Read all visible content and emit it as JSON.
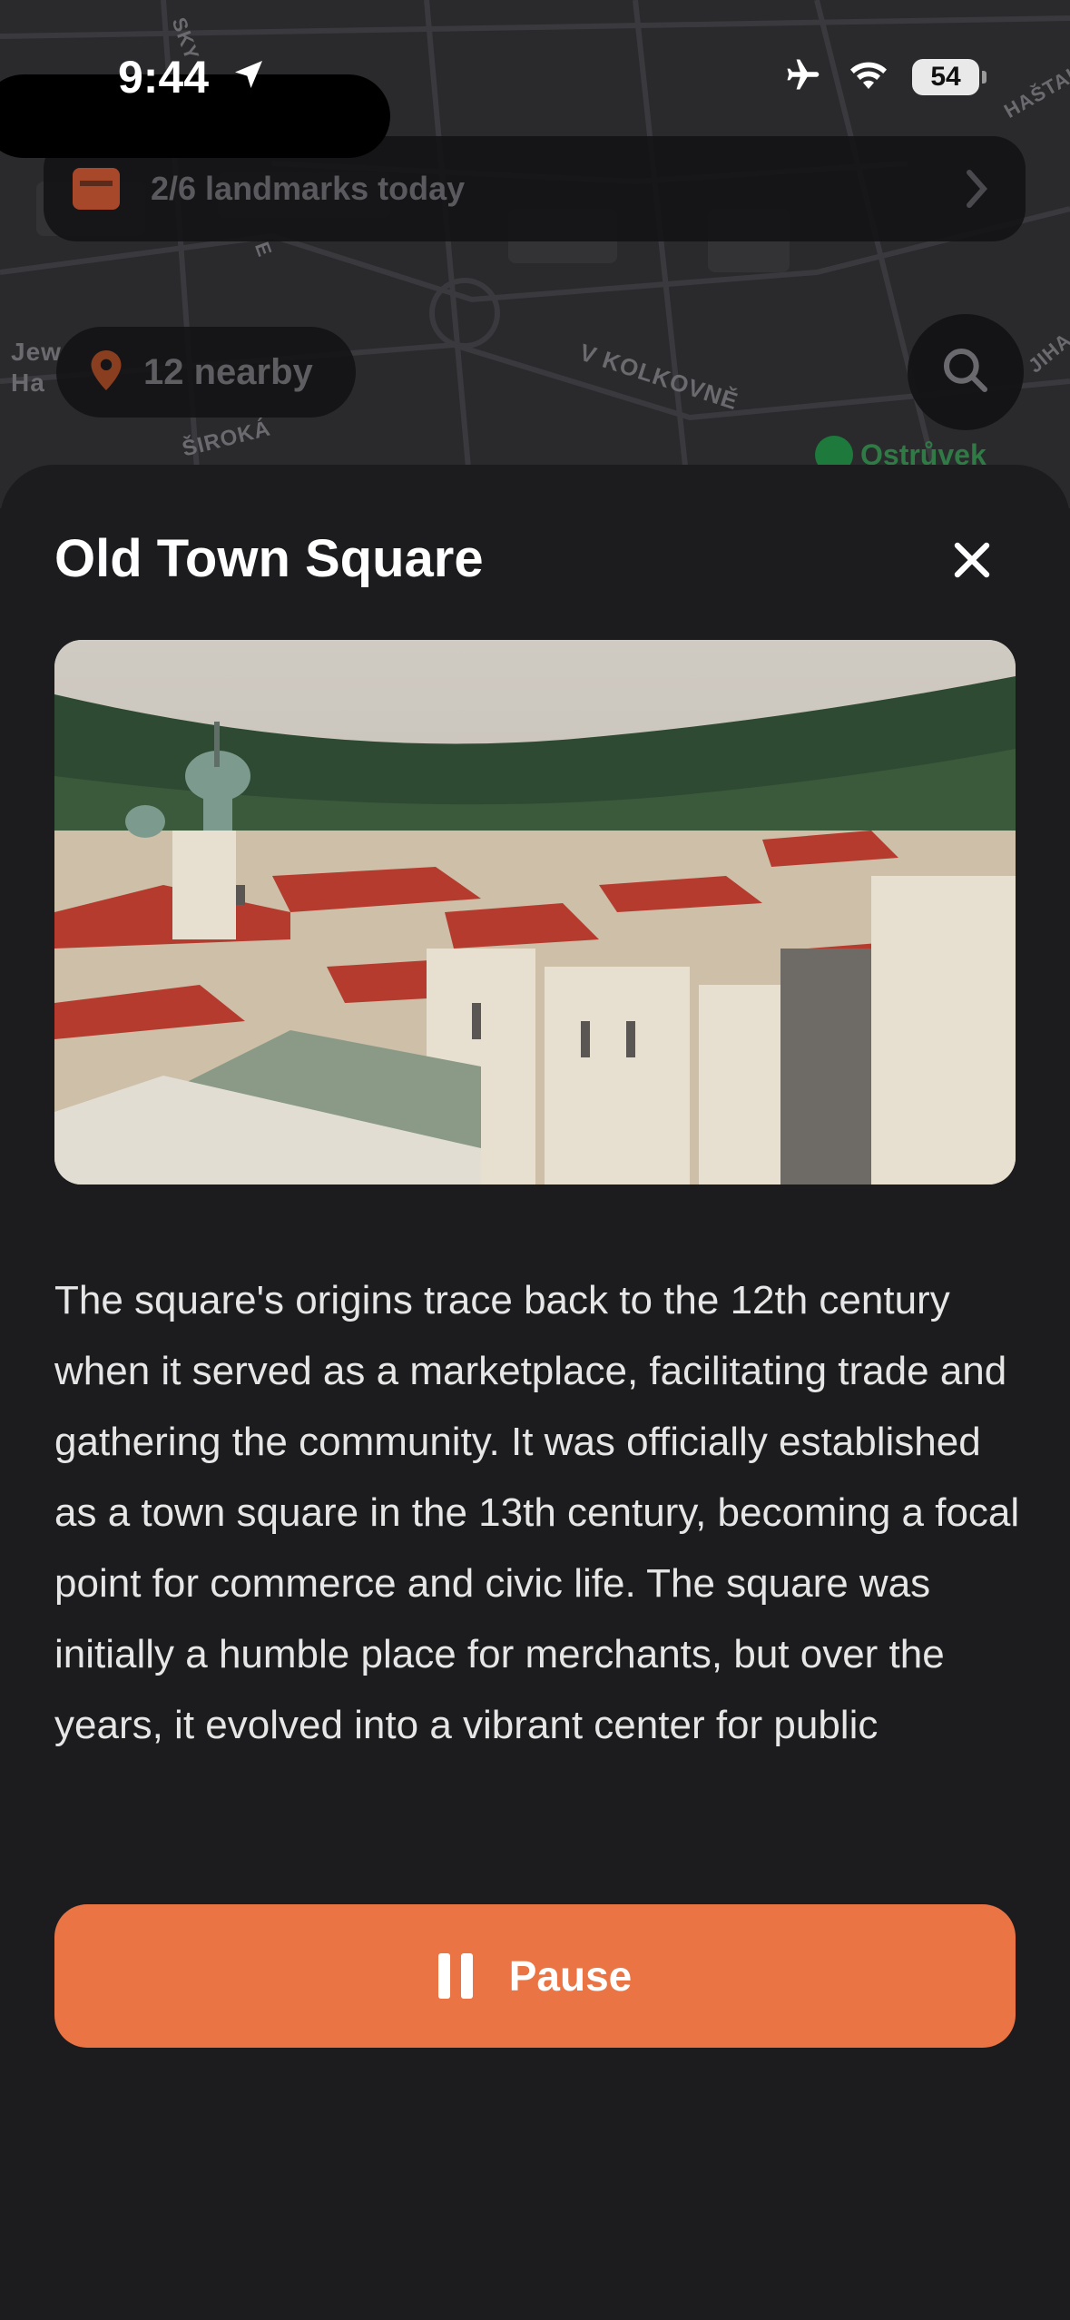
{
  "status_bar": {
    "time": "9:44",
    "battery": "54",
    "icons": [
      "location-arrow-icon",
      "airplane-icon",
      "wifi-icon",
      "battery-icon"
    ]
  },
  "map": {
    "labels": [
      "Jew",
      "Ha",
      "ŠIROKÁ",
      "V KOLKOVNĚ",
      "HAŠTALSK",
      "JIHA",
      "SKY",
      "E"
    ],
    "poi_label": "Ostrůvek"
  },
  "landmarks": {
    "text": "2/6 landmarks today",
    "icon": "ticket-icon"
  },
  "nearby": {
    "text": "12 nearby",
    "icon": "pin-icon"
  },
  "search": {
    "icon": "search-icon"
  },
  "sheet": {
    "title": "Old Town Square",
    "description": "The square's origins trace back to the 12th century when it served as a marketplace, facilitating trade and gathering the community. It was officially established as a town square in the 13th century, becoming a focal point for commerce and civic life. The square was initially a humble place for merchants, but over the years, it evolved into a vibrant center for public",
    "pause_label": "Pause"
  },
  "colors": {
    "accent": "#ea7444",
    "sheet_bg": "#1c1c1e",
    "map_bg": "#2a2a2d"
  }
}
